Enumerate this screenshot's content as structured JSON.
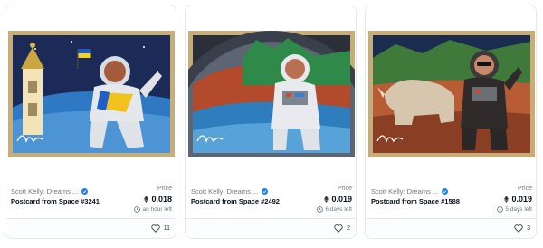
{
  "cards": [
    {
      "collection": "Scott Kelly: Dreams ...",
      "title": "Postcard from Space #3241",
      "price_label": "Price",
      "price": "0.018",
      "time_left": "an hour left",
      "likes": "11",
      "signature": "S.Kelly",
      "art_theme": "astronaut-with-flag-and-cathedral"
    },
    {
      "collection": "Scott Kelly: Dreams ...",
      "title": "Postcard from Space #2492",
      "price_label": "Price",
      "price": "0.019",
      "time_left": "6 days left",
      "likes": "2",
      "signature": "S.Kelly",
      "art_theme": "astronaut-through-porthole"
    },
    {
      "collection": "Scott Kelly: Dreams ...",
      "title": "Postcard from Space #1588",
      "price_label": "Price",
      "price": "0.019",
      "time_left": "5 days left",
      "likes": "3",
      "signature": "S.Kelly",
      "art_theme": "astronaut-with-rhino"
    }
  ],
  "colors": {
    "frame": "#c9ad78",
    "verified": "#2081e2",
    "muted_text": "#707a83",
    "primary_text": "#04111d"
  },
  "icons": {
    "verified": "verified-badge-icon",
    "currency": "ethereum-icon",
    "time": "clock-icon",
    "likes": "heart-icon"
  }
}
